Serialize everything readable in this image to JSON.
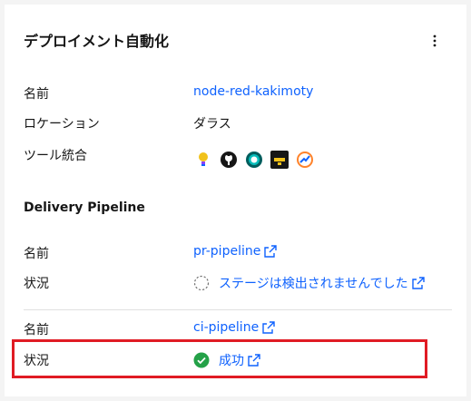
{
  "card": {
    "title": "デプロイメント自動化",
    "overflow_icon": "overflow-menu-vertical-icon"
  },
  "details": {
    "name_label": "名前",
    "name_value": "node-red-kakimoty",
    "location_label": "ロケーション",
    "location_value": "ダラス",
    "tools_label": "ツール統合",
    "tools": [
      {
        "name": "bulb-tool-icon"
      },
      {
        "name": "github-icon"
      },
      {
        "name": "ring-tool-icon"
      },
      {
        "name": "dark-tile-tool-icon"
      },
      {
        "name": "chart-tool-icon"
      }
    ]
  },
  "delivery": {
    "title": "Delivery Pipeline",
    "pipelines": [
      {
        "name_label": "名前",
        "name_value": "pr-pipeline",
        "status_label": "状況",
        "status_value": "ステージは検出されませんでした",
        "status_icon": "pending-dashed-circle-icon"
      },
      {
        "name_label": "名前",
        "name_value": "ci-pipeline",
        "status_label": "状況",
        "status_value": "成功",
        "status_icon": "success-check-circle-icon",
        "success_color": "#24a148"
      }
    ]
  },
  "colors": {
    "link": "#0f62fe",
    "highlight": "#e01b24"
  }
}
